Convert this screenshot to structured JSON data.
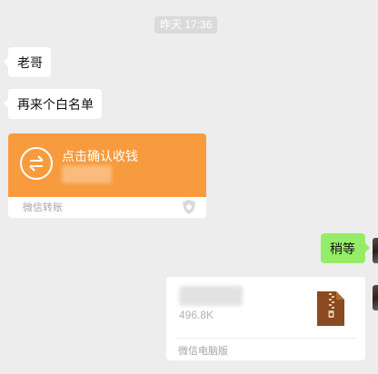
{
  "timestamp": "昨天 17:36",
  "messages": {
    "received_1": "老哥",
    "received_2": "再来个白名单",
    "transfer": {
      "title": "点击确认收钱",
      "footer": "微信转账",
      "color": "#f79b3e"
    },
    "sent_1": "稍等",
    "file": {
      "size": "496.8K",
      "footer": "微信电脑版",
      "icon": "zip-file-icon"
    }
  },
  "colors": {
    "background": "#ededed",
    "sent_bubble": "#95ec69",
    "received_bubble": "#ffffff",
    "transfer": "#f79b3e"
  }
}
